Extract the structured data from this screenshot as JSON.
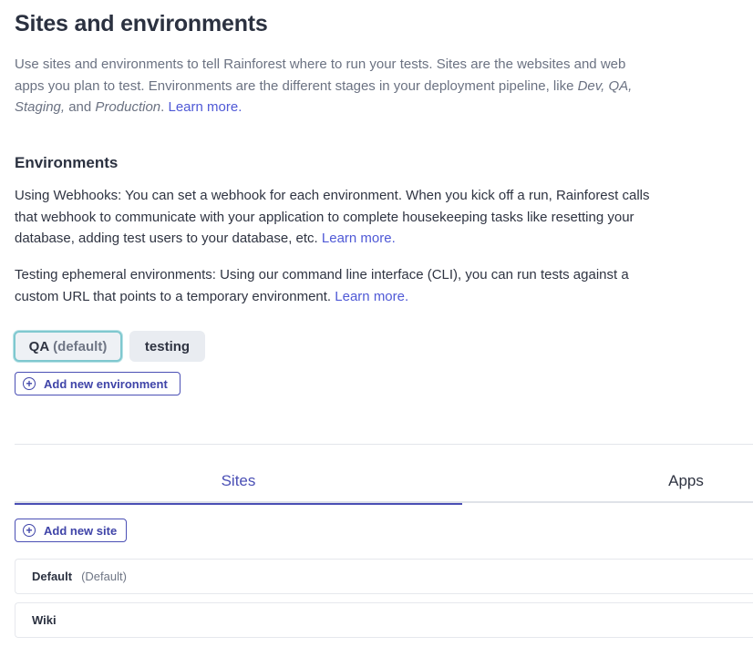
{
  "header": {
    "title": "Sites and environments"
  },
  "intro": {
    "text_1": "Use sites and environments to tell Rainforest where to run your tests. Sites are the websites and web apps you plan to test. Environments are the different stages in your deployment pipeline, like ",
    "env_dev": "Dev, QA, Staging,",
    "text_2": " and ",
    "env_prod": "Production",
    "text_3": ". ",
    "learn_more": "Learn more."
  },
  "environments": {
    "title": "Environments",
    "webhooks_text": "Using Webhooks: You can set a webhook for each environment. When you kick off a run, Rainforest calls that webhook to communicate with your application to complete housekeeping tasks like resetting your database, adding test users to your database, etc. ",
    "webhooks_link": "Learn more.",
    "ephemeral_text": "Testing ephemeral environments: Using our command line interface (CLI), you can run tests against a custom URL that points to a temporary environment. ",
    "ephemeral_link": "Learn more.",
    "tabs": [
      {
        "label": "QA",
        "tag": "(default)",
        "active": true
      },
      {
        "label": "testing",
        "active": false
      }
    ],
    "add_button": "Add new environment",
    "add_icon": "plus-circle-icon"
  },
  "site_tabs": {
    "items": [
      {
        "label": "Sites",
        "active": true
      },
      {
        "label": "Apps",
        "active": false
      }
    ],
    "accent_color": "#4a4fb5"
  },
  "sites": {
    "add_button": "Add new site",
    "add_icon": "plus-circle-icon",
    "rows": [
      {
        "name": "Default",
        "tag": "(Default)"
      },
      {
        "name": "Wiki",
        "tag": ""
      }
    ]
  }
}
